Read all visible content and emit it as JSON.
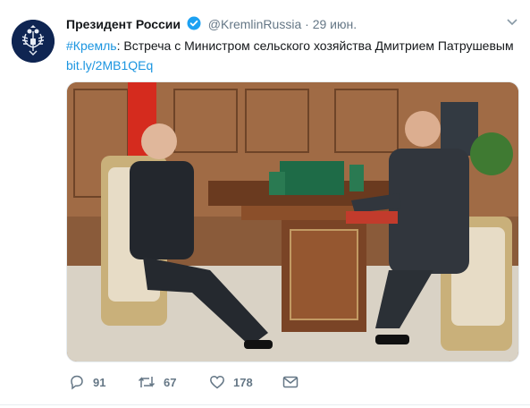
{
  "tweet": {
    "author_name": "Президент России",
    "handle": "@KremlinRussia",
    "separator": "·",
    "date": "29 июн.",
    "hashtag": "#Кремль",
    "text_rest": ": Встреча с Министром сельского хозяйства Дмитрием Патрушевым",
    "link": "bit.ly/2MB1QEq",
    "avatar_icon": "russian-emblem-icon",
    "verified_icon": "verified-badge-icon",
    "menu_icon": "chevron-down-icon",
    "accent_color": "#1b95e0"
  },
  "actions": {
    "reply_count": "91",
    "retweet_count": "67",
    "like_count": "178",
    "icons": [
      "reply-icon",
      "retweet-icon",
      "like-icon",
      "message-icon"
    ]
  }
}
